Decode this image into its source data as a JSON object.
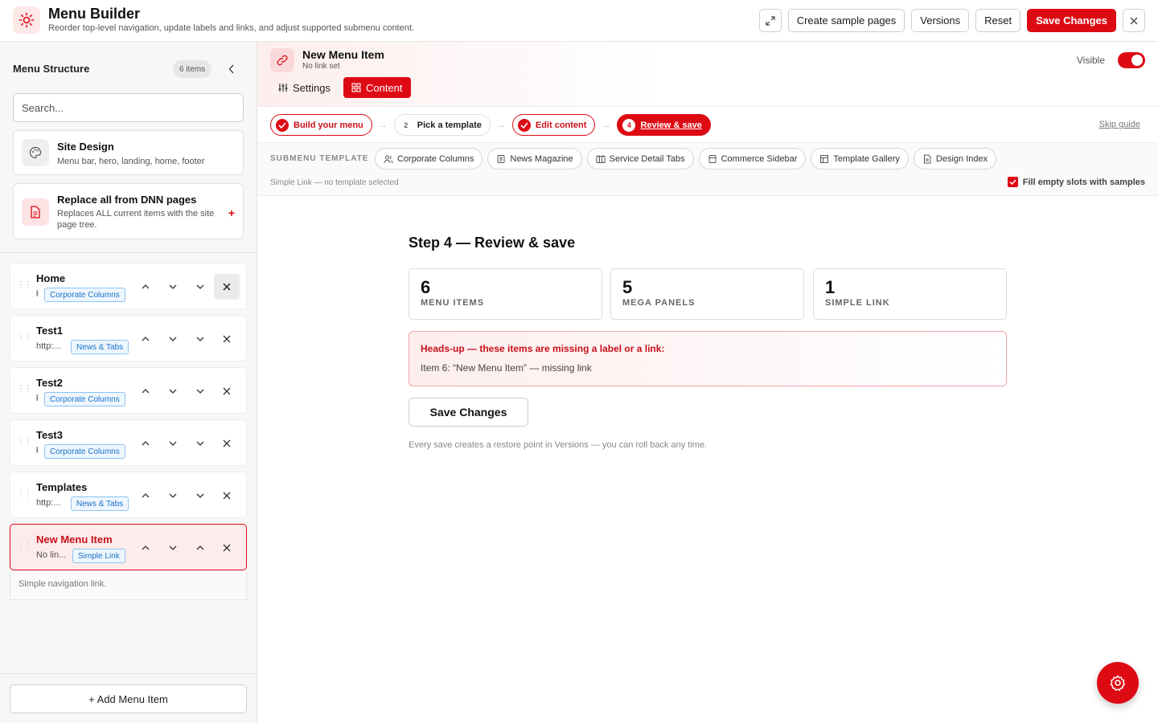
{
  "app": {
    "title": "Menu Builder",
    "subtitle": "Reorder top-level navigation, update labels and links, and adjust supported submenu content."
  },
  "toolbar": {
    "create_sample": "Create sample pages",
    "versions": "Versions",
    "reset": "Reset",
    "save": "Save Changes"
  },
  "sidebar": {
    "title": "Menu Structure",
    "count": "6 items",
    "search_placeholder": "Search...",
    "design_card": {
      "title": "Site Design",
      "desc": "Menu bar, hero, landing, home, footer"
    },
    "replace_card": {
      "title": "Replace all from DNN pages",
      "desc": "Replaces ALL current items with the site page tree.",
      "plus": "+"
    },
    "items": [
      {
        "label": "Home",
        "sub": "ł",
        "badge": "Corporate Columns"
      },
      {
        "label": "Test1",
        "sub": "http:...",
        "badge": "News & Tabs"
      },
      {
        "label": "Test2",
        "sub": "ł",
        "badge": "Corporate Columns"
      },
      {
        "label": "Test3",
        "sub": "ł",
        "badge": "Corporate Columns"
      },
      {
        "label": "Templates",
        "sub": "http:...",
        "badge": "News & Tabs"
      },
      {
        "label": "New Menu Item",
        "sub": "No lin...",
        "badge": "Simple Link"
      }
    ],
    "selected_note": "Simple navigation link.",
    "add_button": "+ Add Menu Item"
  },
  "editor": {
    "title": "New Menu Item",
    "subtitle": "No link set",
    "visible_label": "Visible",
    "visible": true,
    "tabs": {
      "settings": "Settings",
      "content": "Content"
    }
  },
  "steps": {
    "items": [
      {
        "label": "Build your menu",
        "marker": ""
      },
      {
        "label": "Pick a template",
        "marker": "2"
      },
      {
        "label": "Edit content",
        "marker": ""
      },
      {
        "label": "Review & save",
        "marker": "4"
      }
    ],
    "arrow": "→",
    "skip": "Skip guide"
  },
  "templates": {
    "label": "SUBMENU TEMPLATE",
    "chips": [
      "Corporate Columns",
      "News Magazine",
      "Service Detail Tabs",
      "Commerce Sidebar",
      "Template Gallery",
      "Design Index"
    ],
    "status": "Simple Link — no template selected",
    "fill_label": "Fill empty slots with samples",
    "fill_checked": true
  },
  "review": {
    "title": "Step 4 — Review & save",
    "stats": [
      {
        "value": "6",
        "label": "MENU ITEMS"
      },
      {
        "value": "5",
        "label": "MEGA PANELS"
      },
      {
        "value": "1",
        "label": "SIMPLE LINK"
      }
    ],
    "warning_title": "Heads-up — these items are missing a label or a link:",
    "warning_item": "Item 6: “New Menu Item” — missing link",
    "save_button": "Save Changes",
    "note": "Every save creates a restore point in Versions — you can roll back any time."
  },
  "colors": {
    "accent": "#dd0a14",
    "badge_blue": "#1a73c8"
  }
}
